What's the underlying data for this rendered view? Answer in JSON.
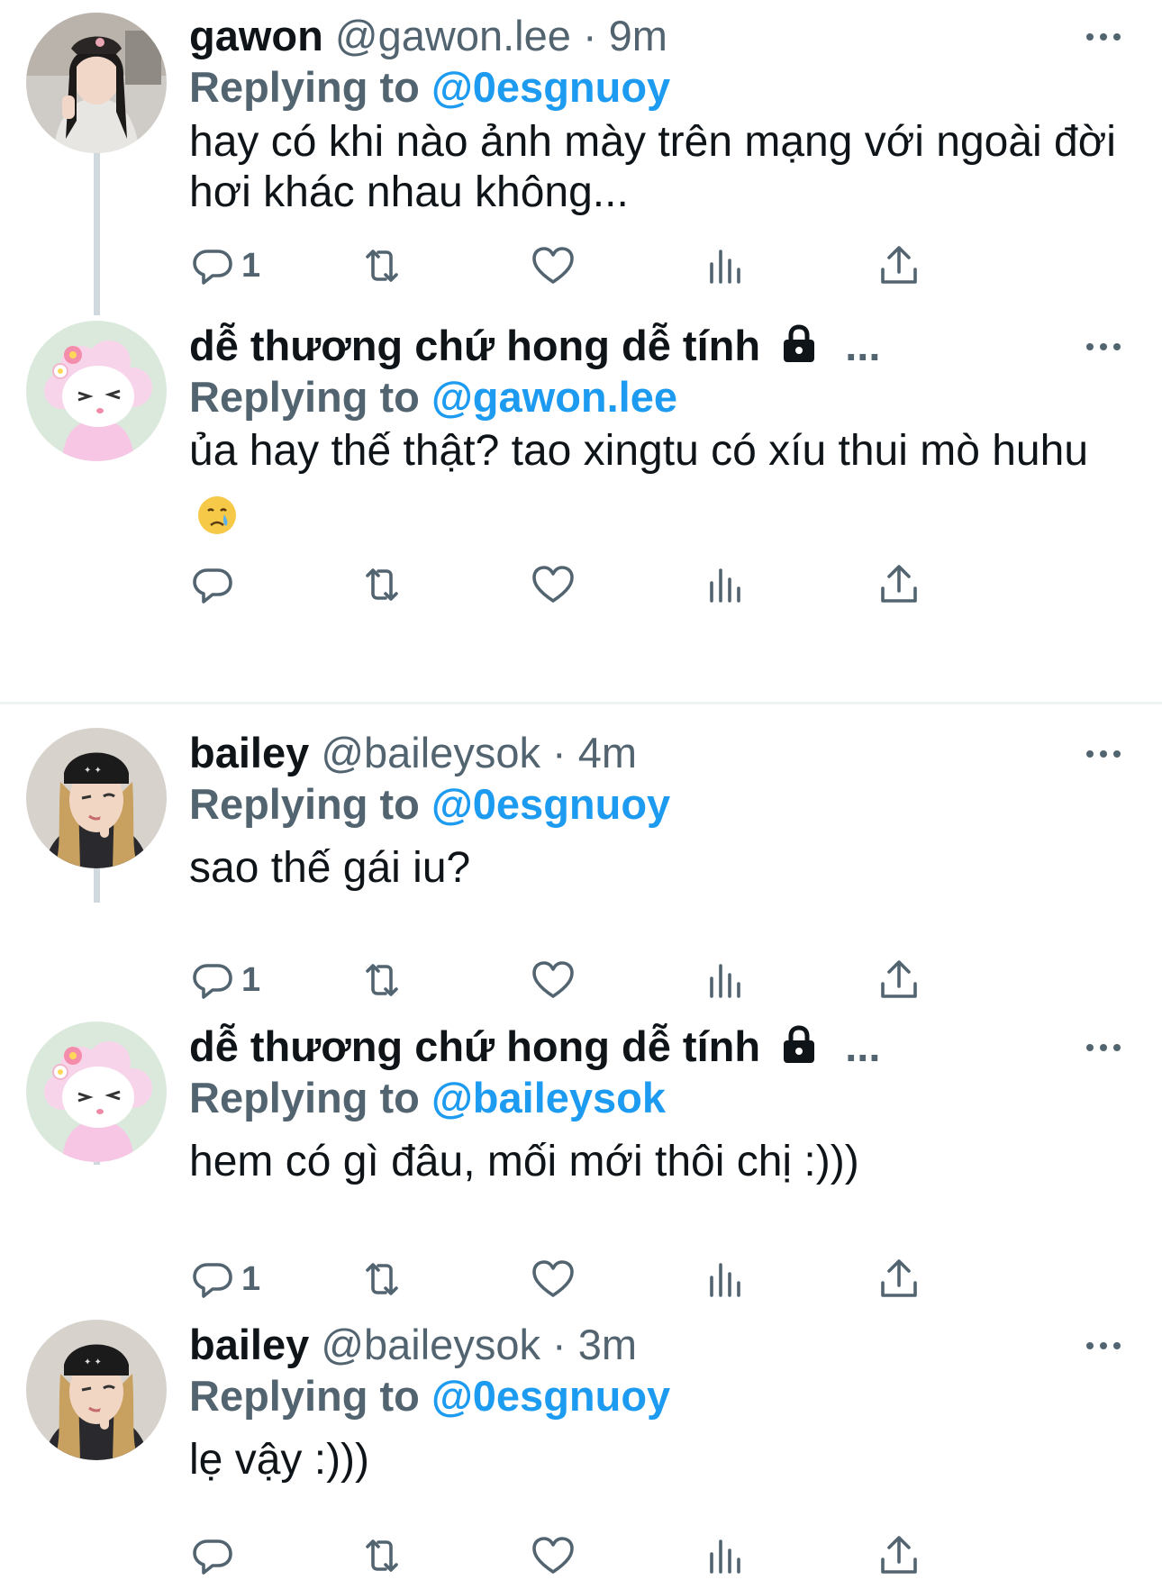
{
  "colors": {
    "accent": "#1d9bf0",
    "secondary_text": "#536471",
    "primary_text": "#0f1419",
    "thread_line": "#cfd9de"
  },
  "tweets": [
    {
      "display_name": "gawon",
      "handle": "@gawon.lee",
      "dot": "·",
      "time": "9m",
      "replying_prefix": "Replying to",
      "replying_to": "@0esgnuoy",
      "text": "hay có khi nào ảnh mày trên mạng với ngoài đời hơi khác nhau không...",
      "reply_count": "1",
      "avatar": "photo-avatar-gawon"
    },
    {
      "display_name": "dễ thương chứ hong dễ tính",
      "name_suffix": "...",
      "locked": true,
      "replying_prefix": "Replying to",
      "replying_to": "@gawon.lee",
      "text": "ủa hay thế thật? tao xingtu có xíu thui mò huhu",
      "emoji": "crying-face-emoji",
      "reply_count": "",
      "avatar": "sheep-avatar"
    },
    {
      "display_name": "bailey",
      "handle": "@baileysok",
      "dot": "·",
      "time": "4m",
      "replying_prefix": "Replying to",
      "replying_to": "@0esgnuoy",
      "text": "sao thế gái iu?",
      "reply_count": "1",
      "avatar": "photo-avatar-bailey"
    },
    {
      "display_name": "dễ thương chứ hong dễ tính",
      "name_suffix": "...",
      "locked": true,
      "replying_prefix": "Replying to",
      "replying_to": "@baileysok",
      "text": "hem có gì đâu, mối mới thôi chị :)))",
      "reply_count": "1",
      "avatar": "sheep-avatar"
    },
    {
      "display_name": "bailey",
      "handle": "@baileysok",
      "dot": "·",
      "time": "3m",
      "replying_prefix": "Replying to",
      "replying_to": "@0esgnuoy",
      "text": "lẹ vậy :)))",
      "reply_count": "",
      "avatar": "photo-avatar-bailey"
    }
  ],
  "action_icons": [
    "reply-icon",
    "retweet-icon",
    "like-icon",
    "views-icon",
    "share-icon"
  ]
}
